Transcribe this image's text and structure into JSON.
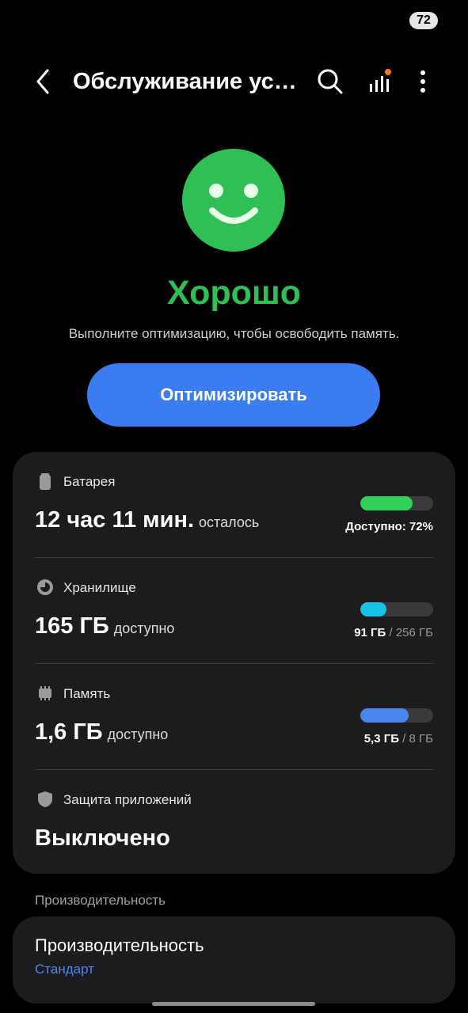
{
  "status_bar": {
    "battery_badge": "72"
  },
  "header": {
    "title": "Обслуживание устройства"
  },
  "hero": {
    "status": "Хорошо",
    "subtitle": "Выполните оптимизацию, чтобы освободить память.",
    "optimize_label": "Оптимизировать"
  },
  "battery": {
    "label": "Батарея",
    "value": "12 час 11 мин.",
    "suffix": "осталось",
    "caption": "Доступно: 72%",
    "fill_fraction": 0.72,
    "bar_color": "#32d158",
    "icon": "battery-icon"
  },
  "storage": {
    "label": "Хранилище",
    "value": "165 ГБ",
    "suffix": "доступно",
    "used": "91 ГБ",
    "total": "/ 256 ГБ",
    "fill_fraction": 0.36,
    "bar_color": "#17c2e6",
    "icon": "storage-pie-icon"
  },
  "memory": {
    "label": "Память",
    "value": "1,6 ГБ",
    "suffix": "доступно",
    "used": "5,3 ГБ",
    "total": "/ 8 ГБ",
    "fill_fraction": 0.66,
    "bar_color": "#4a86ef",
    "icon": "memory-chip-icon"
  },
  "app_protection": {
    "label": "Защита приложений",
    "value": "Выключено",
    "icon": "shield-icon"
  },
  "performance_section": {
    "header": "Производительность",
    "item_title": "Производительность",
    "item_value": "Стандарт"
  },
  "colors": {
    "accent_green": "#2fbf55",
    "button_blue": "#3b7cf0",
    "link_blue": "#4a86ef"
  }
}
